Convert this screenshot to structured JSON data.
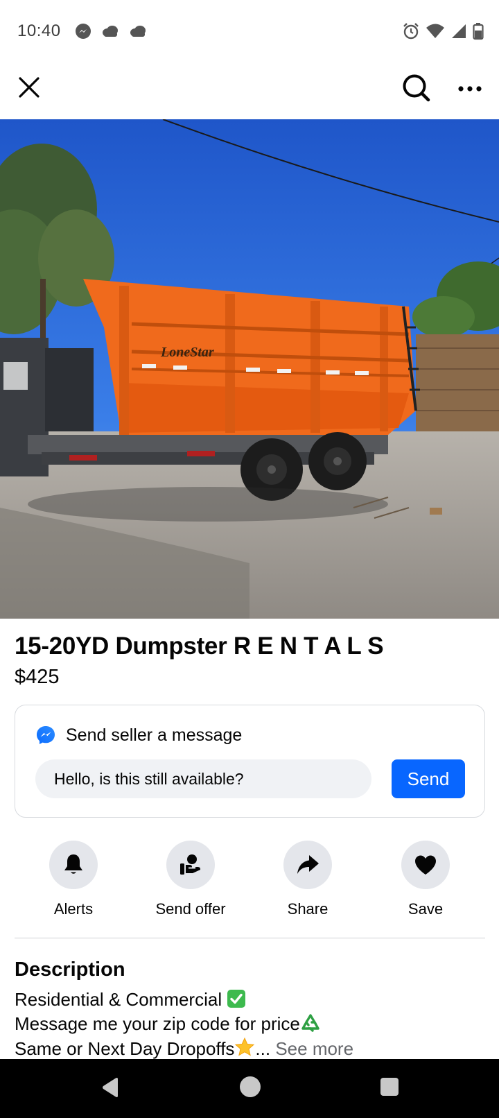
{
  "status_bar": {
    "time": "10:40",
    "left_icons": [
      "messenger-icon",
      "cloud-icon",
      "cloud-icon"
    ],
    "right_icons": [
      "alarm-icon",
      "wifi-icon",
      "signal-icon",
      "battery-icon"
    ]
  },
  "top_bar": {
    "close_icon": "close-icon",
    "search_icon": "search-icon",
    "more_icon": "more-icon"
  },
  "photo": {
    "brand_text": "LoneStar"
  },
  "listing": {
    "title": "15-20YD Dumpster R E N T A L S",
    "price": "$425"
  },
  "message_card": {
    "heading": "Send seller a message",
    "input_value": "Hello, is this still available?",
    "send_label": "Send"
  },
  "actions": [
    {
      "label": "Alerts",
      "icon": "bell-icon"
    },
    {
      "label": "Send offer",
      "icon": "offer-icon"
    },
    {
      "label": "Share",
      "icon": "share-icon"
    },
    {
      "label": "Save",
      "icon": "heart-icon"
    }
  ],
  "description": {
    "heading": "Description",
    "line1": "Residential & Commercial",
    "line2": "Message me your zip code for price",
    "line3": "Same or Next Day Dropoffs",
    "ellipsis": "...",
    "see_more": "See more"
  },
  "colors": {
    "primary": "#0866ff",
    "text": "#050505",
    "secondary_text": "#65676b",
    "action_bg": "#e4e6eb",
    "input_bg": "#f0f2f5",
    "dumpster": "#f06a1c"
  }
}
